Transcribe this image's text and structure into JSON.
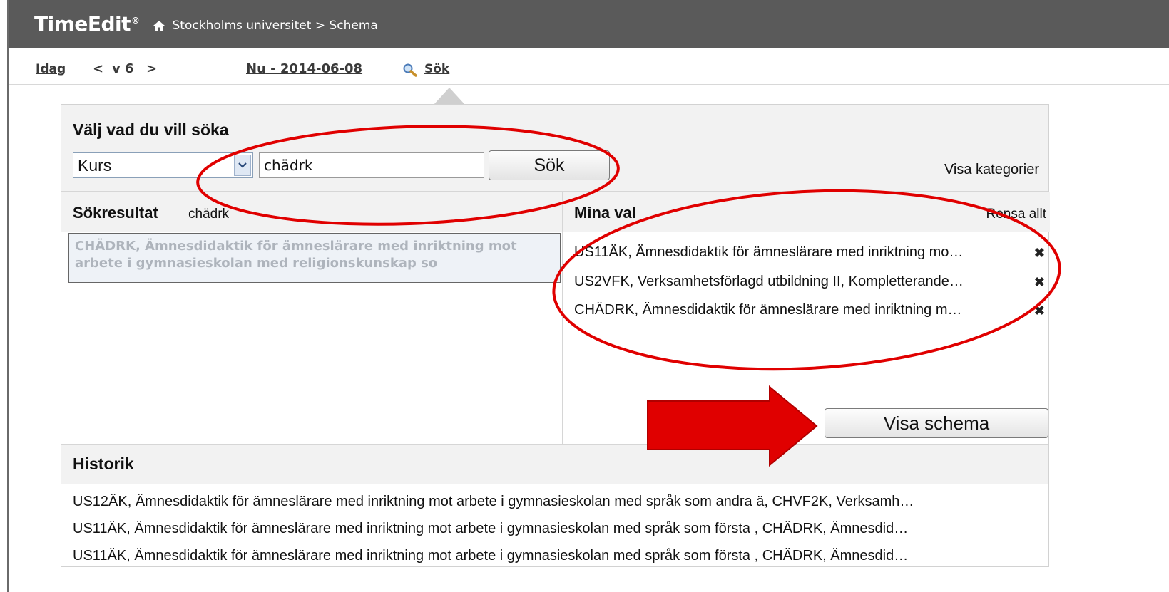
{
  "header": {
    "logo": "TimeEdit",
    "logo_mark": "®",
    "breadcrumb": "Stockholms universitet > Schema",
    "home_icon": "home-icon"
  },
  "nav": {
    "today": "Idag",
    "prev": "<",
    "week": "v 6",
    "next": ">",
    "range_start": "Nu",
    "range_sep": " - ",
    "range_end": "2014-06-08",
    "search_label": "Sök",
    "search_icon": "magnifier-icon"
  },
  "search": {
    "title": "Välj vad du vill söka",
    "type_value": "Kurs",
    "query": "chädrk",
    "button_label": "Sök",
    "show_categories": "Visa kategorier"
  },
  "results": {
    "title": "Sökresultat",
    "query_label": "chädrk",
    "items": [
      "CHÄDRK, Ämnesdidaktik för ämneslärare med inriktning mot arbete i gymnasieskolan med religionskunskap so"
    ]
  },
  "selections": {
    "title": "Mina val",
    "clear_all": "Rensa allt",
    "remove_icon": "close-icon",
    "items": [
      "US11ÄK, Ämnesdidaktik för ämneslärare med inriktning mo…",
      "US2VFK, Verksamhetsförlagd utbildning II, Kompletterande…",
      "CHÄDRK, Ämnesdidaktik för ämneslärare med inriktning m…"
    ],
    "remove_symbol": "✖",
    "show_schedule": "Visa schema"
  },
  "history": {
    "title": "Historik",
    "items": [
      "US12ÄK, Ämnesdidaktik för ämneslärare med inriktning mot arbete i gymnasieskolan med språk som andra ä, CHVF2K, Verksamh…",
      "US11ÄK, Ämnesdidaktik för ämneslärare med inriktning mot arbete i gymnasieskolan med språk som första , CHÄDRK, Ämnesdid…",
      "US11ÄK, Ämnesdidaktik för ämneslärare med inriktning mot arbete i gymnasieskolan med språk som första , CHÄDRK, Ämnesdid…"
    ]
  },
  "annotation_colors": {
    "ellipse": "#e00000",
    "arrow": "#e00000"
  }
}
